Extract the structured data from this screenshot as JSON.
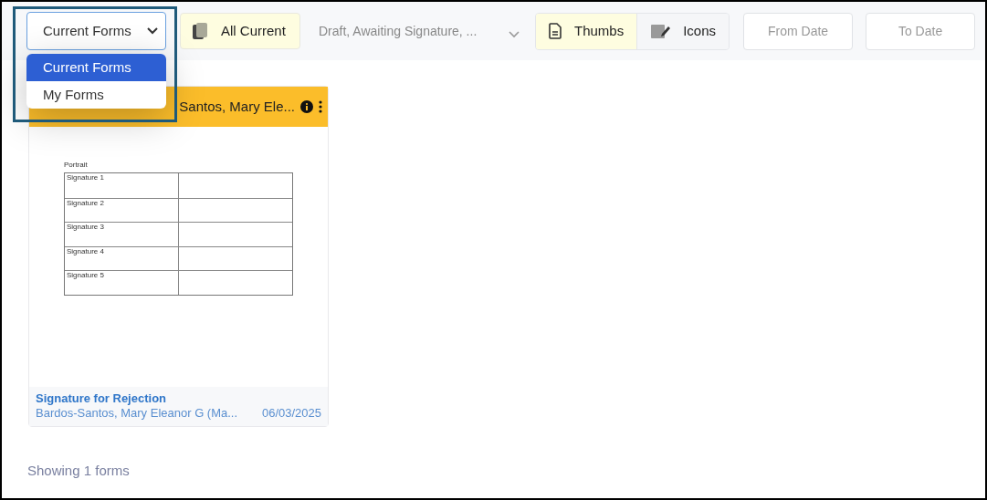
{
  "toolbar": {
    "form_set_select": {
      "value": "Current Forms",
      "options": [
        {
          "label": "Current Forms",
          "selected": true
        },
        {
          "label": "My Forms",
          "selected": false
        }
      ]
    },
    "scope_button": {
      "label": "All Current"
    },
    "status_filter": {
      "value": "Draft, Awaiting Signature, ..."
    },
    "view_toggle": [
      {
        "kind": "thumbs",
        "label": "Thumbs",
        "selected": true
      },
      {
        "kind": "icons",
        "label": "Icons",
        "selected": false
      }
    ],
    "from_date": {
      "placeholder": "From Date"
    },
    "to_date": {
      "placeholder": "To Date"
    }
  },
  "forms": [
    {
      "header": "Santos, Mary Ele...",
      "thumbnail": {
        "heading": "Portrait",
        "rows": [
          "Signature 1",
          "Signature 2",
          "Signature 3",
          "Signature 4",
          "Signature 5"
        ]
      },
      "title": "Signature for Rejection",
      "owner": "Bardos-Santos, Mary Eleanor G (Ma...",
      "date": "06/03/2025"
    }
  ],
  "footer": "Showing 1 forms"
}
